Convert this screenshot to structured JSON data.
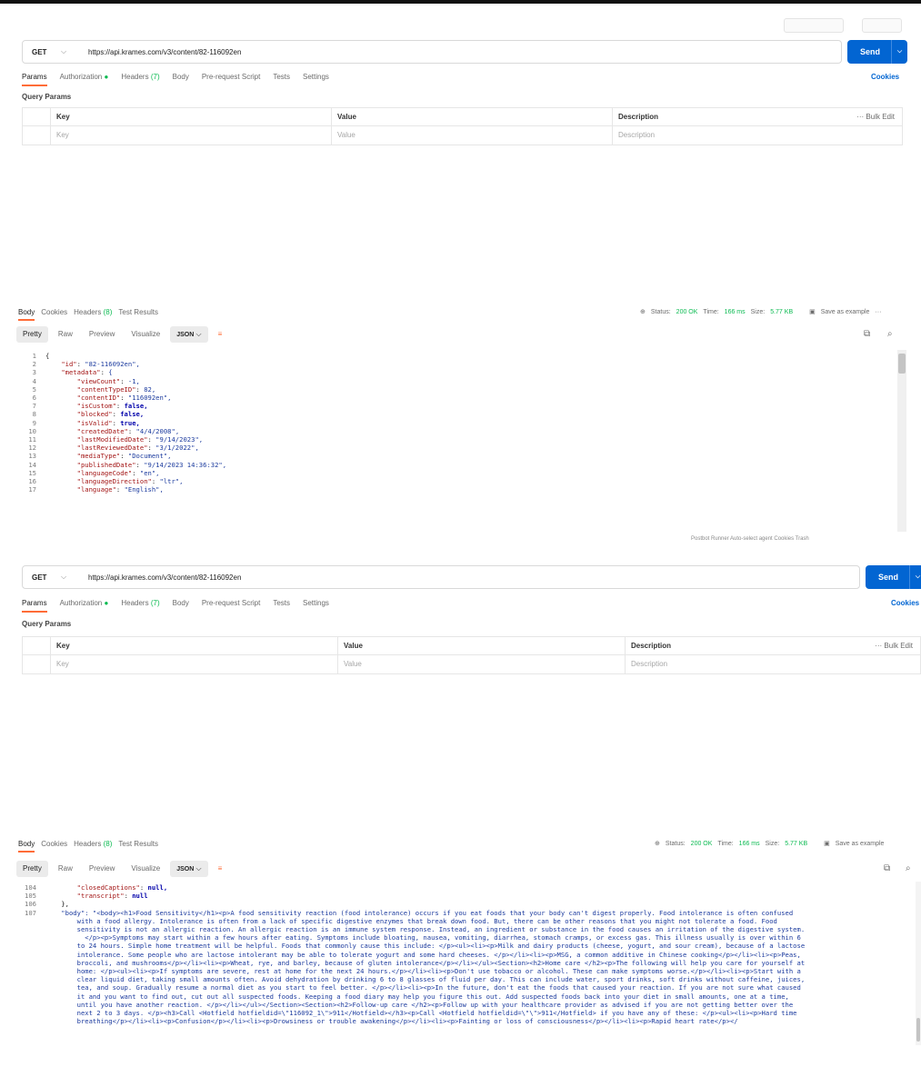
{
  "request": {
    "method": "GET",
    "url": "https://api.krames.com/v3/content/82-116092en",
    "send_label": "Send",
    "cookies_label": "Cookies",
    "tabs": [
      {
        "label": "Params"
      },
      {
        "label": "Authorization",
        "dot": "●"
      },
      {
        "label": "Headers",
        "count": "(7)"
      },
      {
        "label": "Body"
      },
      {
        "label": "Pre-request Script"
      },
      {
        "label": "Tests"
      },
      {
        "label": "Settings"
      }
    ],
    "query_params_title": "Query Params",
    "table": {
      "headers": [
        "Key",
        "Value",
        "Description"
      ],
      "bulk_edit": "Bulk Edit",
      "bulk_dots": "···",
      "placeholders": [
        "Key",
        "Value",
        "Description"
      ]
    }
  },
  "response": {
    "tabs": [
      {
        "label": "Body"
      },
      {
        "label": "Cookies"
      },
      {
        "label": "Headers",
        "count": "(8)"
      },
      {
        "label": "Test Results"
      }
    ],
    "status_label": "Status:",
    "status_value": "200 OK",
    "time_label": "Time:",
    "time_value": "166 ms",
    "size_label": "Size:",
    "size_value": "5.77 KB",
    "save_label": "Save as example",
    "more_dots": "···",
    "view_tabs": [
      "Pretty",
      "Raw",
      "Preview",
      "Visualize"
    ],
    "format": "JSON",
    "colors": {
      "accent": "#ff6c37",
      "send": "#0265d2",
      "status": "#0cbb52"
    }
  },
  "code1": {
    "line_numbers": [
      "1",
      "2",
      "3",
      "4",
      "5",
      "6",
      "7",
      "8",
      "9",
      "10",
      "11",
      "12",
      "13",
      "14",
      "15",
      "16",
      "17"
    ],
    "lines": [
      "{",
      "    \"id\": \"82-116092en\",",
      "    \"metadata\": {",
      "        \"viewCount\": -1,",
      "        \"contentTypeID\": 82,",
      "        \"contentID\": \"116092en\",",
      "        \"isCustom\": false,",
      "        \"blocked\": false,",
      "        \"isValid\": true,",
      "        \"createdDate\": \"4/4/2008\",",
      "        \"lastModifiedDate\": \"9/14/2023\",",
      "        \"lastReviewedDate\": \"3/1/2022\",",
      "        \"mediaType\": \"Document\",",
      "        \"publishedDate\": \"9/14/2023 14:36:32\",",
      "        \"languageCode\": \"en\",",
      "        \"languageDirection\": \"ltr\",",
      "        \"language\": \"English\","
    ]
  },
  "code2": {
    "line_numbers": [
      "104",
      "105",
      "106",
      "107",
      "",
      "",
      "",
      "",
      "",
      "",
      "",
      "",
      "",
      "",
      "",
      "",
      ""
    ],
    "lines": [
      "        \"closedCaptions\": null,",
      "        \"transcript\": null",
      "    },",
      "    \"body\": \"<body><h1>Food Sensitivity</h1><p>A food sensitivity reaction (food intolerance) occurs if you eat foods that your body can't digest properly. Food intolerance is often confused",
      "        with a food allergy. Intolerance is often from a lack of specific digestive enzymes that break down food. But, there can be other reasons that you might not tolerate a food. Food",
      "        sensitivity is not an allergic reaction. An allergic reaction is an immune system response. Instead, an ingredient or substance in the food causes an irritation of the digestive system.",
      "          </p><p>Symptoms may start within a few hours after eating. Symptoms include bloating, nausea, vomiting, diarrhea, stomach cramps, or excess gas. This illness usually is over within 6",
      "        to 24 hours. Simple home treatment will be helpful. Foods that commonly cause this include: </p><ul><li><p>Milk and dairy products (cheese, yogurt, and sour cream), because of a lactose",
      "        intolerance. Some people who are lactose intolerant may be able to tolerate yogurt and some hard cheeses. </p></li><li><p>MSG, a common additive in Chinese cooking</p></li><li><p>Peas,",
      "        broccoli, and mushrooms</p></li><li><p>Wheat, rye, and barley, because of gluten intolerance</p></li></ul><Section><h2>Home care </h2><p>The following will help you care for yourself at",
      "        home: </p><ul><li><p>If symptoms are severe, rest at home for the next 24 hours.</p></li><li><p>Don't use tobacco or alcohol. These can make symptoms worse.</p></li><li><p>Start with a",
      "        clear liquid diet, taking small amounts often. Avoid dehydration by drinking 6 to 8 glasses of fluid per day. This can include water, sport drinks, soft drinks without caffeine, juices,",
      "        tea, and soup. Gradually resume a normal diet as you start to feel better. </p></li><li><p>In the future, don't eat the foods that caused your reaction. If you are not sure what caused",
      "        it and you want to find out, cut out all suspected foods. Keeping a food diary may help you figure this out. Add suspected foods back into your diet in small amounts, one at a time,",
      "        until you have another reaction. </p></li></ul></Section><Section><h2>Follow-up care </h2><p>Follow up with your healthcare provider as advised if you are not getting better over the",
      "        next 2 to 3 days. </p><h3>Call <Hotfield hotfieldid=\\\"116092_1\\\">911</Hotfield></h3><p>Call <Hotfield hotfieldid=\\\"\\\">911</Hotfield> if you have any of these: </p><ul><li><p>Hard time",
      "        breathing</p></li><li><p>Confusion</p></li><li><p>Drowsiness or trouble awakening</p></li><li><p>Fainting or loss of consciousness</p></li><li><p>Rapid heart rate</p></"
    ]
  },
  "footer": "Postbot   Runner   Auto-select agent   Cookies   Trash"
}
